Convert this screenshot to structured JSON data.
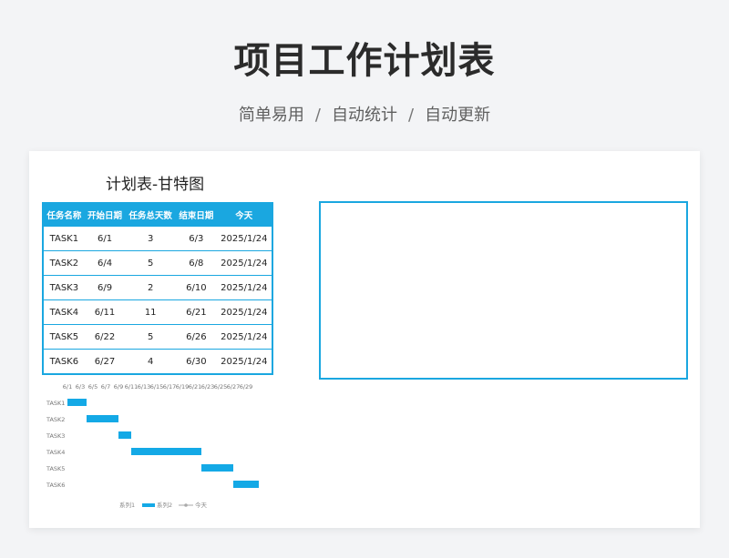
{
  "header": {
    "title": "项目工作计划表",
    "tagline": [
      "简单易用",
      "自动统计",
      "自动更新"
    ],
    "separator": "/"
  },
  "sheet": {
    "title": "计划表-甘特图",
    "columns": [
      "任务名称",
      "开始日期",
      "任务总天数",
      "结束日期",
      "今天"
    ],
    "rows": [
      [
        "TASK1",
        "6/1",
        "3",
        "6/3",
        "2025/1/24"
      ],
      [
        "TASK2",
        "6/4",
        "5",
        "6/8",
        "2025/1/24"
      ],
      [
        "TASK3",
        "6/9",
        "2",
        "6/10",
        "2025/1/24"
      ],
      [
        "TASK4",
        "6/11",
        "11",
        "6/21",
        "2025/1/24"
      ],
      [
        "TASK5",
        "6/22",
        "5",
        "6/26",
        "2025/1/24"
      ],
      [
        "TASK6",
        "6/27",
        "4",
        "6/30",
        "2025/1/24"
      ]
    ]
  },
  "colors": {
    "accent": "#1aa7e0",
    "bar": "#14a9e6"
  },
  "chart_data": {
    "type": "bar",
    "orientation": "horizontal-stacked",
    "x_ticks": [
      "6/1",
      "6/3",
      "6/5",
      "6/7",
      "6/9",
      "6/11",
      "6/13",
      "6/15",
      "6/17",
      "6/19",
      "6/21",
      "6/23",
      "6/25",
      "6/27",
      "6/29"
    ],
    "categories": [
      "TASK1",
      "TASK2",
      "TASK3",
      "TASK4",
      "TASK5",
      "TASK6"
    ],
    "series": [
      {
        "name": "系列1",
        "values": [
          0,
          3,
          8,
          10,
          21,
          26
        ],
        "visible": false
      },
      {
        "name": "系列2",
        "values": [
          3,
          5,
          2,
          11,
          5,
          4
        ],
        "color": "#14a9e6"
      }
    ],
    "legend": [
      "系列1",
      "系列2",
      "今天"
    ],
    "legend_position": "bottom"
  }
}
